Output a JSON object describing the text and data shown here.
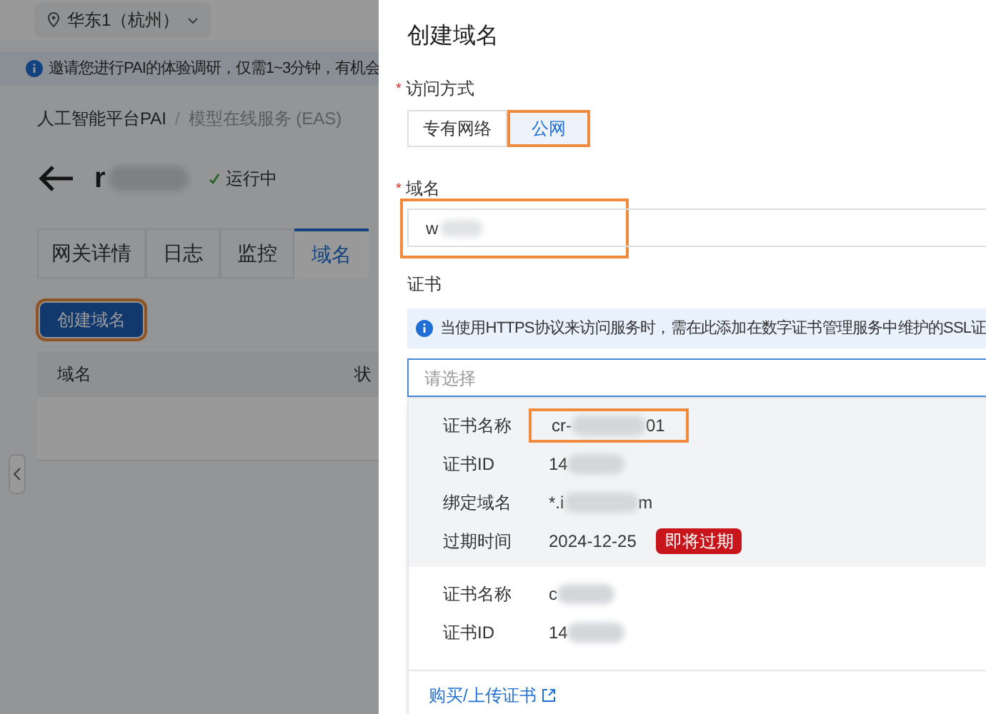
{
  "background_page": {
    "region": "华东1（杭州）",
    "notice": "邀请您进行PAI的体验调研，仅需1~3分钟，有机会",
    "breadcrumb": [
      {
        "label": "人工智能平台PAI"
      },
      {
        "label": "模型在线服务 (EAS)"
      }
    ],
    "breadcrumb_separator": "/",
    "service": {
      "name_start": "r",
      "status": "运行中"
    },
    "tabs": [
      {
        "label": "网关详情",
        "selected": false
      },
      {
        "label": "日志",
        "selected": false
      },
      {
        "label": "监控",
        "selected": false
      },
      {
        "label": "域名",
        "selected": true
      }
    ],
    "create_button": "创建域名",
    "table": {
      "columns": [
        "域名",
        "状"
      ]
    }
  },
  "drawer": {
    "title": "创建域名",
    "access": {
      "label": "访问方式",
      "required_mark": "*",
      "options": [
        {
          "label": "专有网络",
          "selected": false
        },
        {
          "label": "公网",
          "selected": true
        }
      ]
    },
    "domain": {
      "label": "域名",
      "required_mark": "*",
      "value_start": "w"
    },
    "certificate": {
      "label": "证书",
      "info": "当使用HTTPS协议来访问服务时，需在此添加在数字证书管理服务中维护的SSL证",
      "placeholder": "请选择",
      "options": [
        {
          "selected": true,
          "fields": [
            {
              "label": "证书名称",
              "start": "cr-",
              "end": "01",
              "highlighted": true
            },
            {
              "label": "证书ID",
              "start": "14"
            },
            {
              "label": "绑定域名",
              "start": "*.i",
              "end": "m"
            },
            {
              "label": "过期时间",
              "value": "2024-12-25",
              "tag": "即将过期"
            }
          ]
        },
        {
          "selected": false,
          "fields": [
            {
              "label": "证书名称",
              "start": "c"
            },
            {
              "label": "证书ID",
              "start": "14"
            }
          ]
        }
      ],
      "link": "购买/上传证书"
    }
  }
}
